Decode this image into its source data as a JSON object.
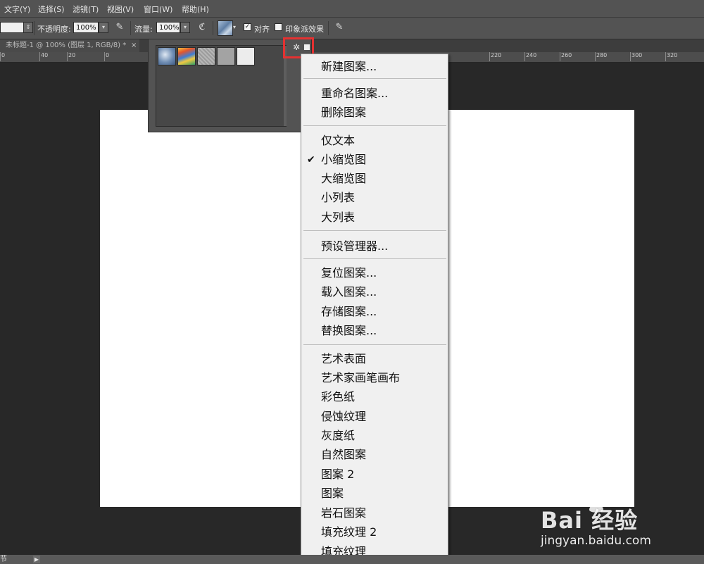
{
  "menubar": {
    "items": [
      "文字(Y)",
      "选择(S)",
      "滤镜(T)",
      "视图(V)",
      "窗口(W)",
      "帮助(H)"
    ]
  },
  "options": {
    "opacity_label": "不透明度:",
    "opacity_value": "100%",
    "flow_label": "流量:",
    "flow_value": "100%",
    "align_label": "对齐",
    "impressionist_label": "印象派效果"
  },
  "tab": {
    "title": "未标题-1 @ 100% (图层 1, RGB/8) *",
    "close": "×"
  },
  "ruler": {
    "ticks": [
      "0",
      "40",
      "20",
      "0",
      "220",
      "240",
      "260",
      "280",
      "300",
      "320"
    ]
  },
  "menu": {
    "items": [
      "新建图案...",
      "重命名图案...",
      "删除图案",
      "仅文本",
      "小缩览图",
      "大缩览图",
      "小列表",
      "大列表",
      "预设管理器...",
      "复位图案...",
      "载入图案...",
      "存储图案...",
      "替换图案...",
      "艺术表面",
      "艺术家画笔画布",
      "彩色纸",
      "侵蚀纹理",
      "灰度纸",
      "自然图案",
      "图案 2",
      "图案",
      "岩石图案",
      "填充纹理 2",
      "填充纹理"
    ],
    "checked": "✔"
  },
  "status": {
    "text": "节"
  },
  "watermark": {
    "brand": "Bai  经验",
    "url": "jingyan.baidu.com"
  },
  "colors": {
    "highlight": "#e43131",
    "canvas": "#ffffff",
    "menu_bg": "#f0f0f0"
  }
}
